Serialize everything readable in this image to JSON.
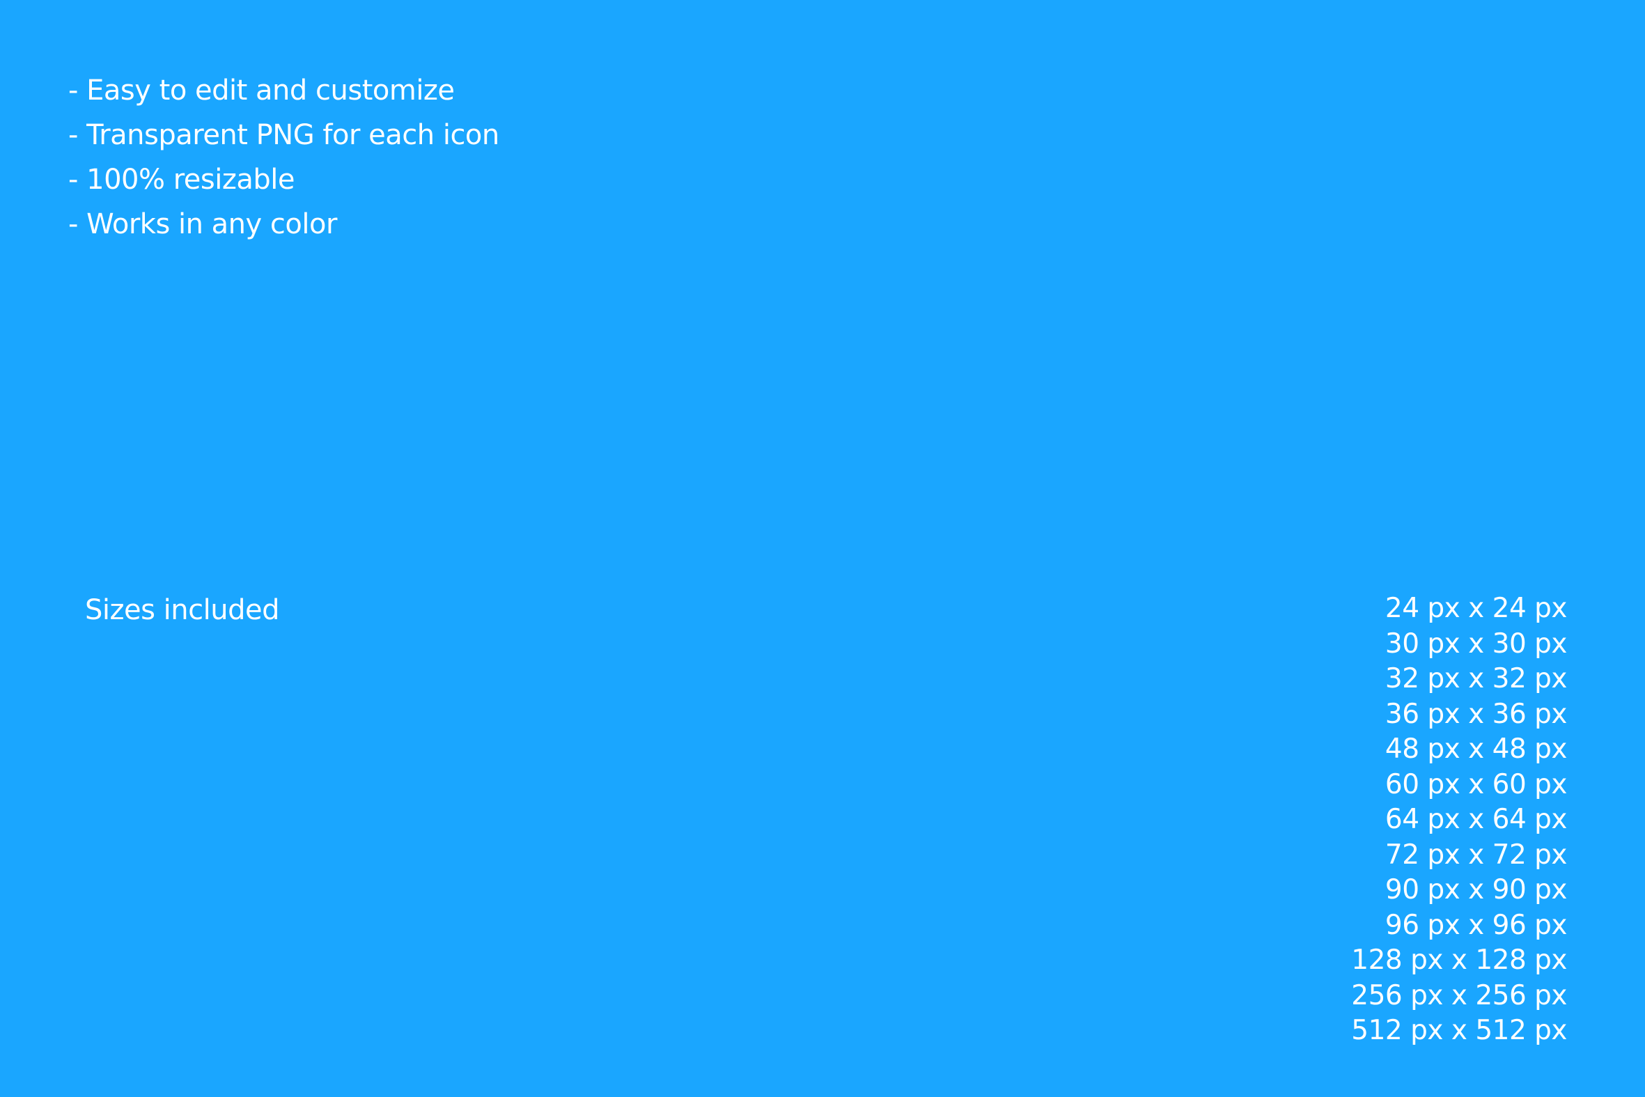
{
  "background_color": "#1aa6ff",
  "text_color": "#ffffff",
  "features": [
    "- Easy to edit and customize",
    "- Transparent PNG for each icon",
    "- 100% resizable",
    "- Works in any color"
  ],
  "sizes": {
    "label": "Sizes included",
    "items": [
      "24 px x 24 px",
      "30 px x 30 px",
      "32 px x 32 px",
      "36 px x 36 px",
      "48 px x 48 px",
      "60 px x 60 px",
      "64 px x 64 px",
      "72 px x 72 px",
      "90 px x 90 px",
      "96 px x 96 px",
      "128 px x 128 px",
      "256 px x 256 px",
      "512 px x 512 px"
    ]
  }
}
